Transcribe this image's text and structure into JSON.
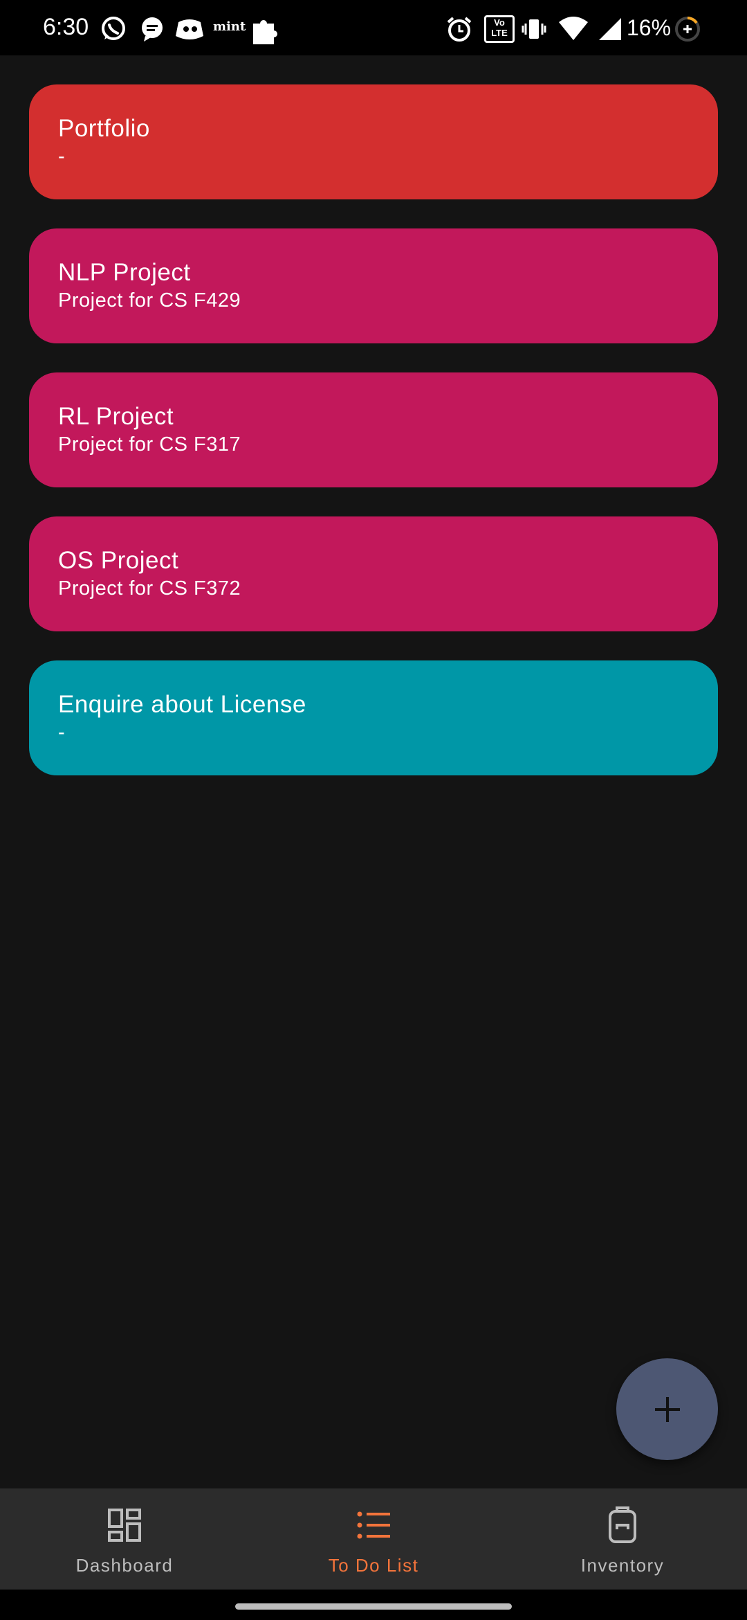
{
  "status_bar": {
    "time": "6:30",
    "battery": "16%",
    "icons": [
      "whatsapp-icon",
      "messages-icon",
      "discord-icon",
      "mint-icon",
      "puzzle-icon",
      "alarm-icon",
      "volte-icon",
      "vibrate-icon",
      "wifi-icon",
      "signal-icon",
      "battery-saver-icon"
    ],
    "mint_label": "mint",
    "volte_label_top": "Vo",
    "volte_label_bottom": "LTE"
  },
  "tasks": [
    {
      "title": "Portfolio",
      "subtitle": "-",
      "color": "#d32f2f"
    },
    {
      "title": "NLP Project",
      "subtitle": "Project for CS F429",
      "color": "#c2185b"
    },
    {
      "title": "RL Project",
      "subtitle": "Project for CS F317",
      "color": "#c2185b"
    },
    {
      "title": "OS Project",
      "subtitle": "Project for CS F372",
      "color": "#c2185b"
    },
    {
      "title": "Enquire about License",
      "subtitle": "-",
      "color": "#0097a7"
    }
  ],
  "fab": {
    "icon": "plus-icon"
  },
  "bottom_nav": {
    "items": [
      {
        "label": "Dashboard",
        "icon": "dashboard-icon",
        "active": false
      },
      {
        "label": "To Do List",
        "icon": "list-icon",
        "active": true
      },
      {
        "label": "Inventory",
        "icon": "backpack-icon",
        "active": false
      }
    ],
    "active_color": "#f4743b",
    "inactive_color": "#bdbdbd"
  }
}
